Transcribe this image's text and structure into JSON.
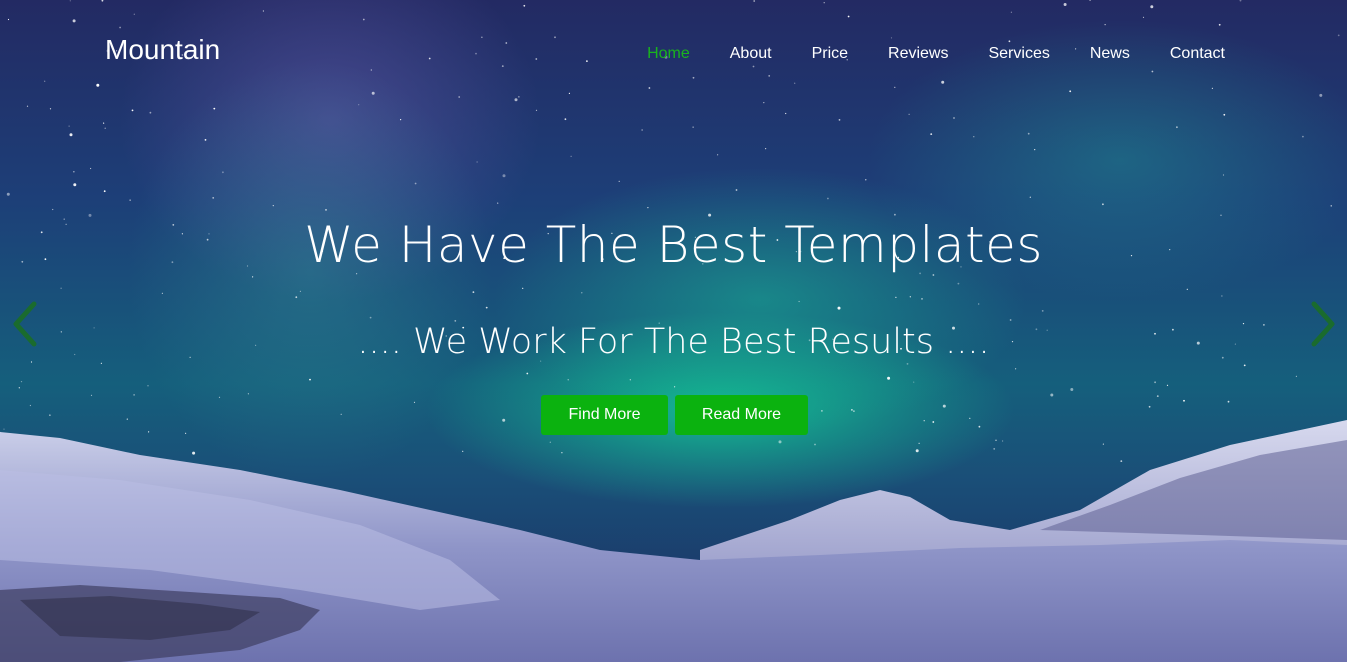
{
  "brand": {
    "name": "Mountain"
  },
  "nav": {
    "items": [
      {
        "label": "Home",
        "active": true
      },
      {
        "label": "About",
        "active": false
      },
      {
        "label": "Price",
        "active": false
      },
      {
        "label": "Reviews",
        "active": false
      },
      {
        "label": "Services",
        "active": false
      },
      {
        "label": "News",
        "active": false
      },
      {
        "label": "Contact",
        "active": false
      }
    ]
  },
  "hero": {
    "title": "We Have The Best Templates",
    "subtitle": ".... We Work For The Best Results ....",
    "buttons": {
      "find_more": "Find More",
      "read_more": "Read More"
    },
    "prev_icon": "chevron-left-icon",
    "next_icon": "chevron-right-icon"
  },
  "colors": {
    "accent": "#0bb20f",
    "active_nav": "#19b31d",
    "arrow": "#1a6b2e",
    "text": "#ffffff"
  }
}
